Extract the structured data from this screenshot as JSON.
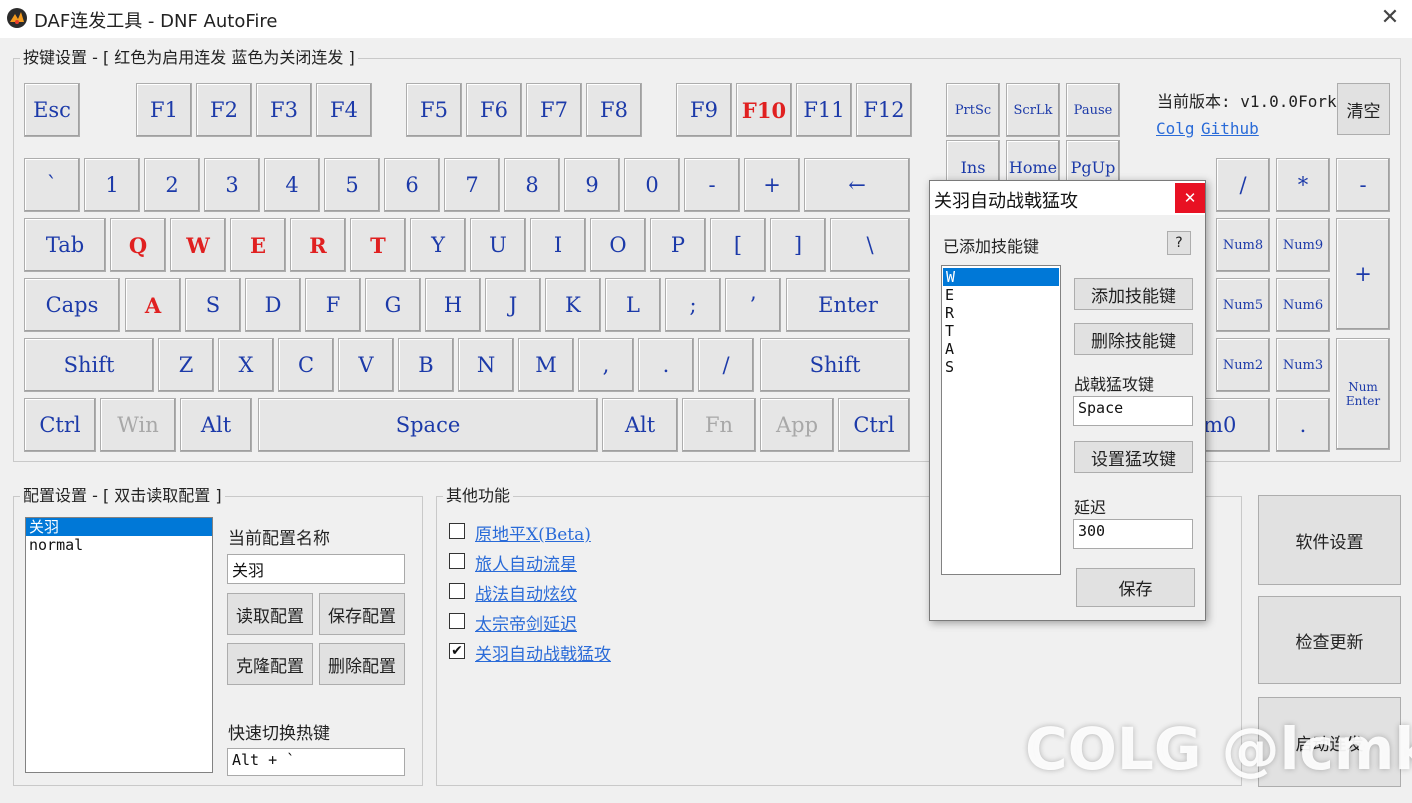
{
  "window": {
    "title": "DAF连发工具 - DNF AutoFire",
    "close_glyph": "✕"
  },
  "keys_group": {
    "title": "按键设置 - [ 红色为启用连发 蓝色为关闭连发 ]"
  },
  "keys": {
    "esc": "Esc",
    "f1": "F1",
    "f2": "F2",
    "f3": "F3",
    "f4": "F4",
    "f5": "F5",
    "f6": "F6",
    "f7": "F7",
    "f8": "F8",
    "f9": "F9",
    "f10": "F10",
    "f11": "F11",
    "f12": "F12",
    "prtsc": "PrtSc",
    "scrlk": "ScrLk",
    "pause": "Pause",
    "backtick": "`",
    "d1": "1",
    "d2": "2",
    "d3": "3",
    "d4": "4",
    "d5": "5",
    "d6": "6",
    "d7": "7",
    "d8": "8",
    "d9": "9",
    "d0": "0",
    "minus": "-",
    "plus": "+",
    "backspace": "←",
    "ins": "Ins",
    "home": "Home",
    "pgup": "PgUp",
    "tab": "Tab",
    "q": "Q",
    "w": "W",
    "e": "E",
    "r": "R",
    "t": "T",
    "y": "Y",
    "u": "U",
    "i": "I",
    "o": "O",
    "p": "P",
    "lbracket": "[",
    "rbracket": "]",
    "backslash": "\\",
    "caps": "Caps",
    "a": "A",
    "s": "S",
    "d": "D",
    "f": "F",
    "g": "G",
    "h": "H",
    "j": "J",
    "k": "K",
    "l": "L",
    "semicolon": ";",
    "quote": "’",
    "enter": "Enter",
    "lshift": "Shift",
    "z": "Z",
    "x": "X",
    "c": "C",
    "v": "V",
    "b": "B",
    "n": "N",
    "m": "M",
    "comma": ",",
    "period": ".",
    "slash": "/",
    "rshift": "Shift",
    "lctrl": "Ctrl",
    "win": "Win",
    "lalt": "Alt",
    "space": "Space",
    "ralt": "Alt",
    "fn": "Fn",
    "app": "App",
    "rctrl": "Ctrl",
    "num_div": "/",
    "num_mul": "*",
    "num_sub": "-",
    "num8": "Num8",
    "num9": "Num9",
    "num_add": "+",
    "num5": "Num5",
    "num6": "Num6",
    "num2": "Num2",
    "num3": "Num3",
    "num_enter_1": "Num",
    "num_enter_2": "Enter",
    "num0": "um0",
    "num_dot": "."
  },
  "version": {
    "label": "当前版本: v1.0.0Fork",
    "clear": "清空",
    "link_colg": "Colg",
    "link_github": "Github"
  },
  "config_group": {
    "title": "配置设置 - [ 双击读取配置 ]",
    "items": [
      "关羽",
      "normal"
    ],
    "name_label": "当前配置名称",
    "name_value": "关羽",
    "load": "读取配置",
    "save": "保存配置",
    "clone": "克隆配置",
    "delete": "删除配置",
    "hotkey_label": "快速切换热键",
    "hotkey_value": "Alt + `"
  },
  "other_group": {
    "title": "其他功能",
    "items": [
      {
        "label": "原地平X(Beta)",
        "checked": false
      },
      {
        "label": "旅人自动流星",
        "checked": false
      },
      {
        "label": "战法自动炫纹",
        "checked": false
      },
      {
        "label": "太宗帝剑延迟",
        "checked": false
      },
      {
        "label": "关羽自动战戟猛攻",
        "checked": true
      }
    ],
    "check_glyph": "✔"
  },
  "right_buttons": {
    "settings": "软件设置",
    "update": "检查更新",
    "start": "启动连发"
  },
  "dialog": {
    "title": "关羽自动战戟猛攻",
    "close_glyph": "✕",
    "skills_label": "已添加技能键",
    "help": "?",
    "skills": [
      "W",
      "E",
      "R",
      "T",
      "A",
      "S"
    ],
    "add": "添加技能键",
    "remove": "删除技能键",
    "attack_label": "战戟猛攻键",
    "attack_value": "Space",
    "set_attack": "设置猛攻键",
    "delay_label": "延迟",
    "delay_value": "300",
    "save": "保存"
  },
  "watermark": "COLG @lcmkc",
  "colors": {
    "enabled_key": "#e02020",
    "disabled_key": "#1c3aa9",
    "selection": "#0078d7",
    "close_red": "#e81123"
  }
}
